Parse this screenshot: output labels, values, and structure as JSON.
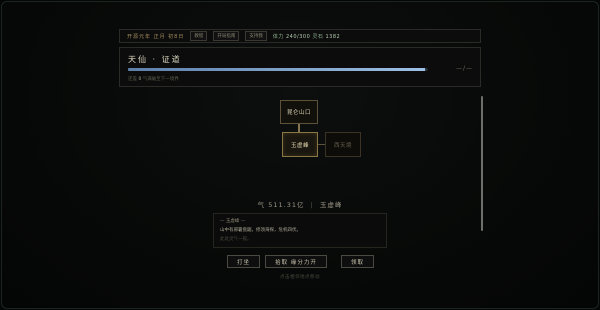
{
  "topbar": {
    "date": "开源元年 正月 初8日",
    "chip1": "教程",
    "chip2": "开局指南",
    "chip3": "支持我",
    "stat_label": "体力",
    "stat_value": "240/300",
    "coin_label": "灵石",
    "coin_value": "1382"
  },
  "realm": {
    "title": "天仙 · 证道",
    "progress_fraction": 0.99,
    "end_mark": "—/—",
    "sub_prefix": "还差",
    "sub_value": "0",
    "sub_suffix": "气满破至下一境界"
  },
  "map": {
    "top_node": "昆仑山口",
    "current_node": "玉虚峰",
    "side_node": "西天境"
  },
  "status": {
    "qi": "气 511.31亿",
    "location": "玉虚峰"
  },
  "log": {
    "header": "— 玉虚峰 —",
    "line": "山中有邪暑盘踞，修须海探，危机四伏。",
    "faint": "此处灵气一般。"
  },
  "actions": {
    "explore": "打坐",
    "pickup": "拾取 缘分力开",
    "collect": "领取"
  },
  "hint": "点击相邻地点移动"
}
